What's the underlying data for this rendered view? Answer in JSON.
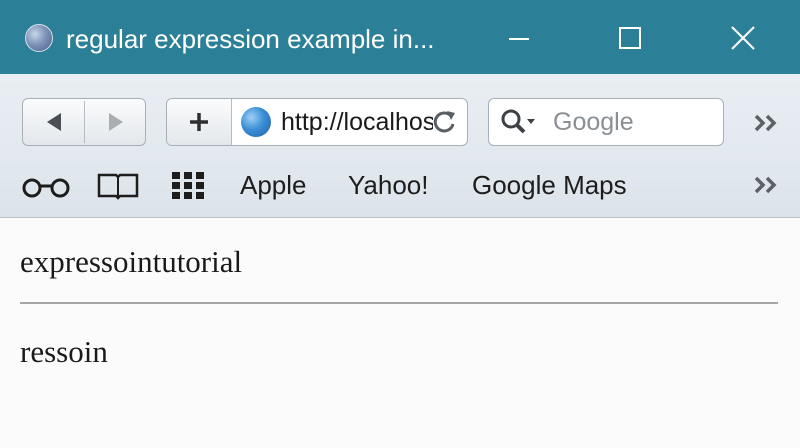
{
  "window": {
    "title": "regular expression example in...",
    "controls": [
      "minimize",
      "maximize",
      "close"
    ]
  },
  "toolbar": {
    "back_icon": "back-arrow-icon",
    "forward_icon": "forward-arrow-icon",
    "add_icon": "plus-icon",
    "address": {
      "icon": "globe-icon",
      "value": "http://localhost"
    },
    "reload_icon": "reload-icon",
    "search": {
      "icon": "search-icon",
      "placeholder": "Google"
    },
    "overflow_icon": "double-chevron-icon"
  },
  "bookmarks": {
    "icons": [
      "reading-glasses-icon",
      "open-book-icon",
      "grid-icon"
    ],
    "items": [
      "Apple",
      "Yahoo!",
      "Google Maps"
    ],
    "overflow_icon": "double-chevron-icon"
  },
  "page": {
    "line1": "expressointutorial",
    "line2": "ressoin"
  },
  "colors": {
    "titlebar": "#2b7f97",
    "toolbar": "#e2e8ee",
    "content": "#fbfbfb"
  }
}
